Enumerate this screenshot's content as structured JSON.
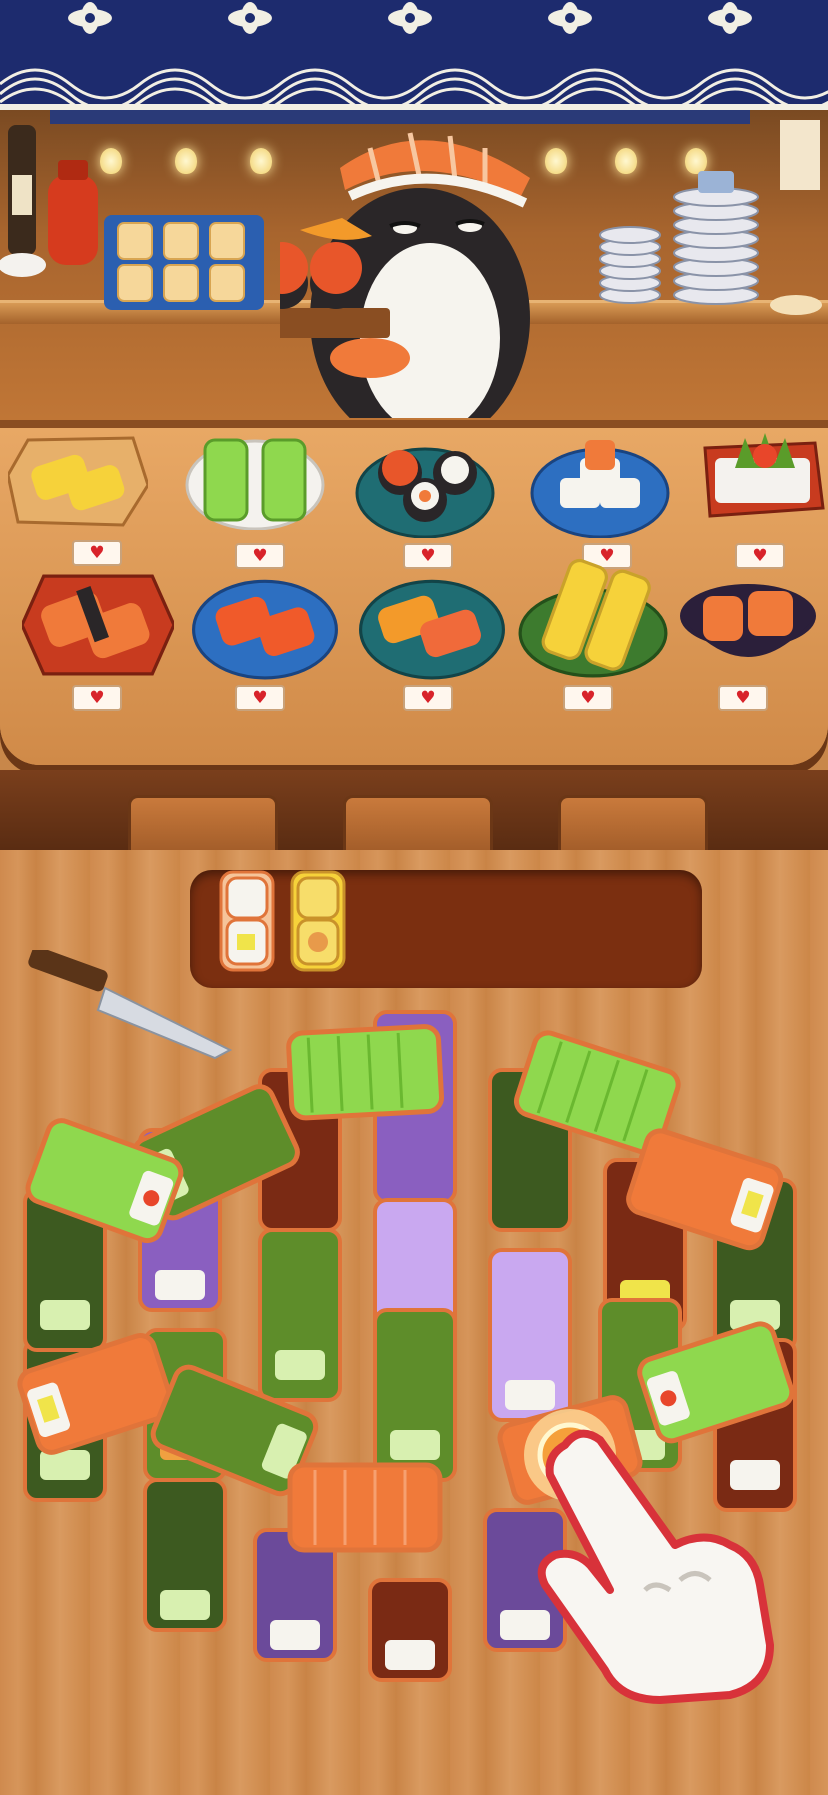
{
  "game": {
    "name": "",
    "mascot": "penguin-sushi-chef",
    "heart_symbol": "♥"
  },
  "counter": {
    "dishes": [
      {
        "id": "tamago-plate",
        "row": 1,
        "col": 1,
        "food": "tamago nigiri",
        "plate_color": "#e7b06a"
      },
      {
        "id": "cucumber-roll-plate",
        "row": 1,
        "col": 2,
        "food": "green wrapped rolls",
        "plate_color": "#f4f2ee"
      },
      {
        "id": "ikura-maki-plate",
        "row": 1,
        "col": 3,
        "food": "ikura & maki",
        "plate_color": "#1f6d73"
      },
      {
        "id": "salmon-stack-plate",
        "row": 1,
        "col": 4,
        "food": "salmon maki stack",
        "plate_color": "#2d6fc1"
      },
      {
        "id": "garnish-plate",
        "row": 1,
        "col": 5,
        "food": "garnished roll",
        "plate_color": "#c83b1f"
      },
      {
        "id": "salmon-nigiri-plate",
        "row": 2,
        "col": 1,
        "food": "salmon nigiri",
        "plate_color": "#c83b1f"
      },
      {
        "id": "salmon-duo-plate",
        "row": 2,
        "col": 2,
        "food": "salmon nigiri duo",
        "plate_color": "#2d6fc1"
      },
      {
        "id": "shrimp-plate",
        "row": 2,
        "col": 3,
        "food": "shrimp nigiri",
        "plate_color": "#1f6d73"
      },
      {
        "id": "tamago-roll-plate",
        "row": 2,
        "col": 4,
        "food": "yellow rolls",
        "plate_color": "#3d7b2e"
      },
      {
        "id": "salmon-bowl",
        "row": 2,
        "col": 5,
        "food": "salmon rolls bowl",
        "plate_color": "#2b1f3a"
      }
    ]
  },
  "tray": {
    "slots_filled": 2,
    "items": [
      {
        "type": "salmon-roll",
        "stack": 2
      },
      {
        "type": "tamago-roll",
        "stack": 2
      }
    ]
  },
  "board": {
    "roll_types": {
      "light-green": "#8fd84e",
      "dark-green": "#5e8d2a",
      "purple": "#8a5fc0",
      "salmon": "#f07a3a",
      "dark-red": "#7a2a14"
    }
  },
  "tutorial": {
    "gesture": "tap",
    "hint_icon": "pointing-hand-icon"
  }
}
